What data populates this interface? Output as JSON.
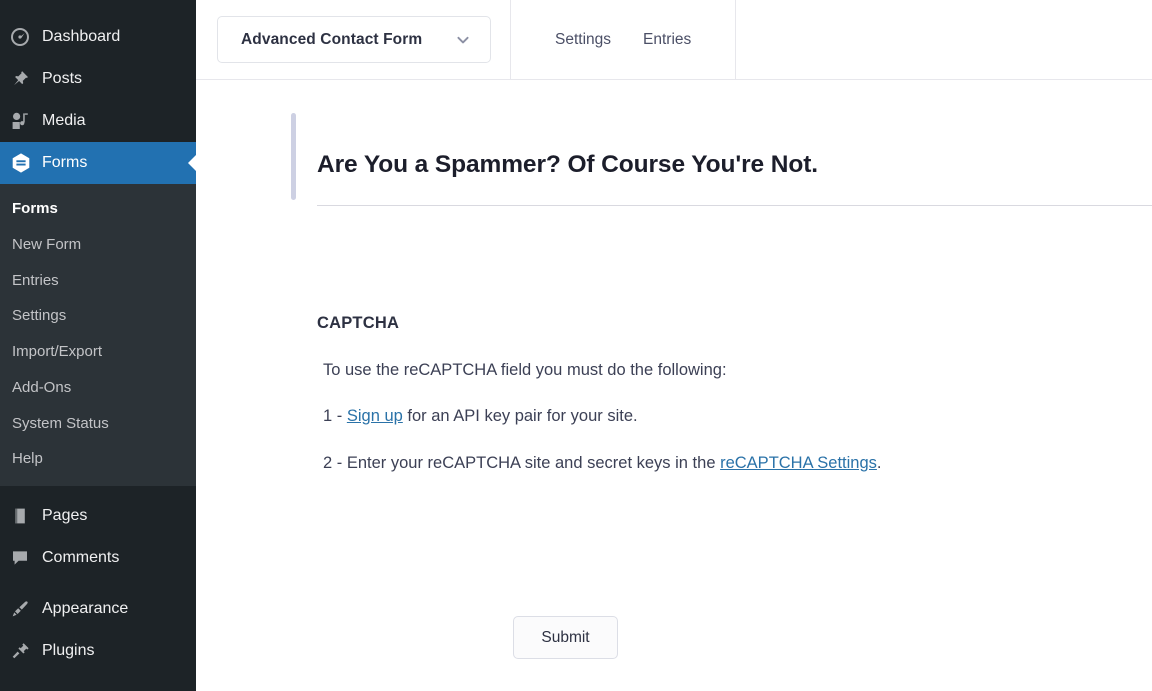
{
  "sidebar": {
    "items": [
      {
        "label": "Dashboard",
        "icon": "dashboard-icon",
        "current": false
      },
      {
        "label": "Posts",
        "icon": "pin-icon",
        "current": false
      },
      {
        "label": "Media",
        "icon": "media-icon",
        "current": false
      },
      {
        "label": "Forms",
        "icon": "forms-icon",
        "current": true
      }
    ],
    "submenu": [
      {
        "label": "Forms",
        "current": true
      },
      {
        "label": "New Form",
        "current": false
      },
      {
        "label": "Entries",
        "current": false
      },
      {
        "label": "Settings",
        "current": false
      },
      {
        "label": "Import/Export",
        "current": false
      },
      {
        "label": "Add-Ons",
        "current": false
      },
      {
        "label": "System Status",
        "current": false
      },
      {
        "label": "Help",
        "current": false
      }
    ],
    "items_lower": [
      {
        "label": "Pages",
        "icon": "pages-icon",
        "current": false
      },
      {
        "label": "Comments",
        "icon": "comments-icon",
        "current": false
      }
    ],
    "items_lower2": [
      {
        "label": "Appearance",
        "icon": "appearance-icon",
        "current": false
      },
      {
        "label": "Plugins",
        "icon": "plugins-icon",
        "current": false
      }
    ],
    "active_color": "#2271b1",
    "background_color": "#1d2327",
    "submenu_background_color": "#2c3338"
  },
  "header": {
    "form_switcher_label": "Advanced Contact Form",
    "chevron_icon": "chevron-down-icon",
    "tabs": [
      {
        "label": "Settings"
      },
      {
        "label": "Entries"
      }
    ]
  },
  "ghost_buttons": [
    {
      "label": ""
    },
    {
      "label": ""
    },
    {
      "label": ""
    },
    {
      "label": ""
    }
  ],
  "canvas": {
    "title_field": {
      "text": "Are You a Spammer? Of Course You're Not.",
      "accent_color": "#cdd0e3"
    },
    "captcha_field": {
      "label": "CAPTCHA",
      "intro": "To use the reCAPTCHA field you must do the following:",
      "step1_prefix": "1 - ",
      "step1_link": "Sign up",
      "step1_suffix": " for an API key pair for your site.",
      "step2_prefix": "2 - Enter your reCAPTCHA site and secret keys in the ",
      "step2_link": "reCAPTCHA Settings",
      "step2_suffix": ".",
      "link_color": "#2a72a8"
    },
    "submit_label": "Submit"
  }
}
